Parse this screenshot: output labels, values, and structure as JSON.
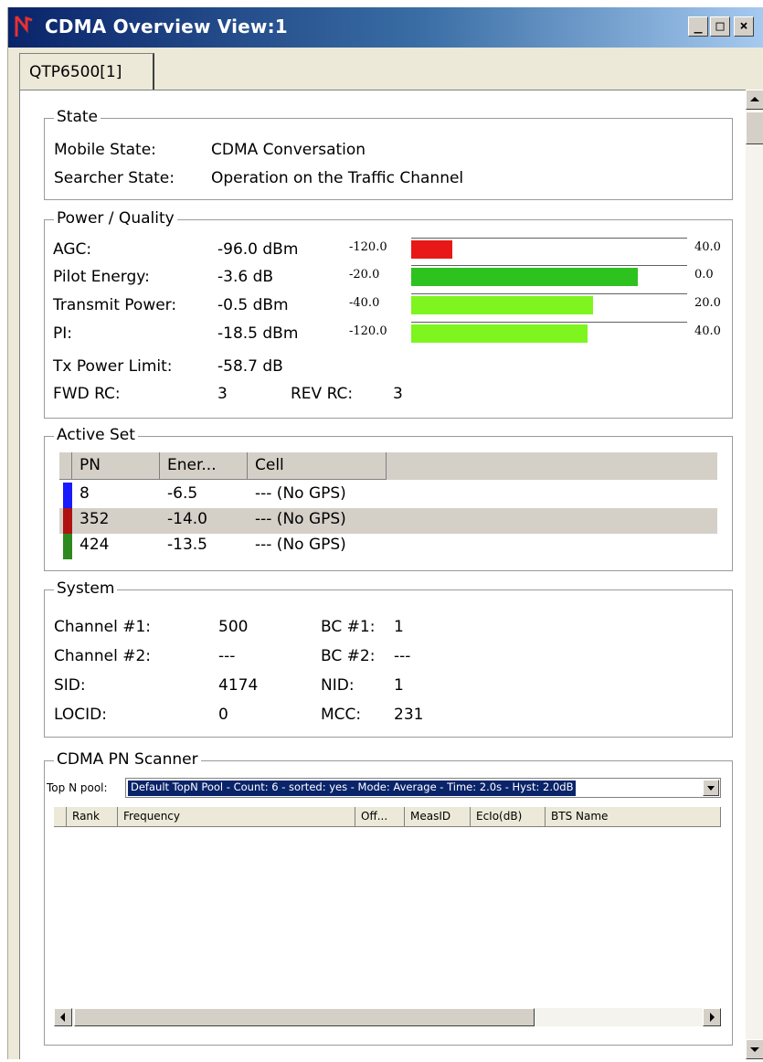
{
  "window": {
    "title": "CDMA Overview View:1",
    "controls": {
      "minimize": "_",
      "maximize": "□",
      "close": "×"
    }
  },
  "tabs": [
    {
      "label": "QTP6500[1]"
    }
  ],
  "state": {
    "legend": "State",
    "rows": [
      {
        "label": "Mobile State:",
        "value": "CDMA Conversation"
      },
      {
        "label": "Searcher State:",
        "value": "Operation on the Traffic Channel"
      }
    ]
  },
  "power": {
    "legend": "Power / Quality",
    "rows": [
      {
        "label": "AGC:",
        "value": "-96.0 dBm",
        "min": "-120.0",
        "max": "40.0",
        "fill": 0.15,
        "color": "#e81818"
      },
      {
        "label": "Pilot Energy:",
        "value": "-3.6 dB",
        "min": "-20.0",
        "max": "0.0",
        "fill": 0.82,
        "color": "#2ec21e"
      },
      {
        "label": "Transmit Power:",
        "value": "-0.5 dBm",
        "min": "-40.0",
        "max": "20.0",
        "fill": 0.66,
        "color": "#7ef51e"
      },
      {
        "label": "PI:",
        "value": "-18.5 dBm",
        "min": "-120.0",
        "max": "40.0",
        "fill": 0.64,
        "color": "#7ef51e"
      }
    ],
    "tx_limit": {
      "label": "Tx Power Limit:",
      "value": "-58.7 dB"
    },
    "fwd_rc": {
      "label": "FWD RC:",
      "value": "3"
    },
    "rev_rc": {
      "label": "REV RC:",
      "value": "3"
    }
  },
  "active_set": {
    "legend": "Active Set",
    "columns": [
      "PN",
      "Ener...",
      "Cell"
    ],
    "rows": [
      {
        "pn": "8",
        "energy": "-6.5",
        "cell": "--- (No GPS)",
        "color": "#1a1aff"
      },
      {
        "pn": "352",
        "energy": "-14.0",
        "cell": "--- (No GPS)",
        "color": "#b01212"
      },
      {
        "pn": "424",
        "energy": "-13.5",
        "cell": "--- (No GPS)",
        "color": "#2e8a1e"
      }
    ]
  },
  "system": {
    "legend": "System",
    "rows": [
      {
        "l1": "Channel #1:",
        "v1": "500",
        "l2": "BC #1:",
        "v2": "1"
      },
      {
        "l1": "Channel #2:",
        "v1": "---",
        "l2": "BC #2:",
        "v2": "---"
      },
      {
        "l1": "SID:",
        "v1": "4174",
        "l2": "NID:",
        "v2": "1"
      },
      {
        "l1": "LOCID:",
        "v1": "0",
        "l2": "MCC:",
        "v2": "231"
      }
    ]
  },
  "scanner": {
    "legend": "CDMA PN Scanner",
    "pool_label": "Top N pool:",
    "pool_value": "Default TopN Pool - Count: 6 - sorted: yes - Mode: Average - Time: 2.0s - Hyst: 2.0dB",
    "columns": [
      "Rank",
      "Frequency",
      "Off...",
      "MeasID",
      "EcIo(dB)",
      "BTS Name"
    ]
  }
}
